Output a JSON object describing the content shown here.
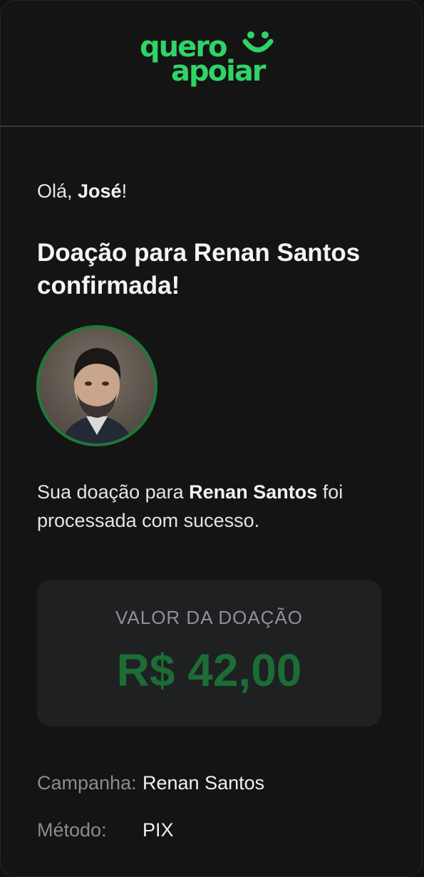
{
  "brand": {
    "logo_line1": "quero",
    "logo_line2": "apoiar",
    "accent_color": "#2fd466",
    "icon": "smile-icon"
  },
  "greeting": {
    "prefix": "Olá, ",
    "name": "José",
    "suffix": "!"
  },
  "title": "Doação para Renan Santos confirmada!",
  "avatar": {
    "icon": "candidate-avatar",
    "ring_color": "#1c7a36"
  },
  "message": {
    "prefix": "Sua doação para ",
    "recipient": "Renan Santos",
    "suffix": " foi processada com sucesso."
  },
  "donation": {
    "label": "VALOR DA DOAÇÃO",
    "amount": "R$ 42,00",
    "amount_color": "#1b6d35"
  },
  "details": {
    "campaign_label": "Campanha:",
    "campaign_value": "Renan Santos",
    "method_label": "Método:",
    "method_value": "PIX"
  }
}
